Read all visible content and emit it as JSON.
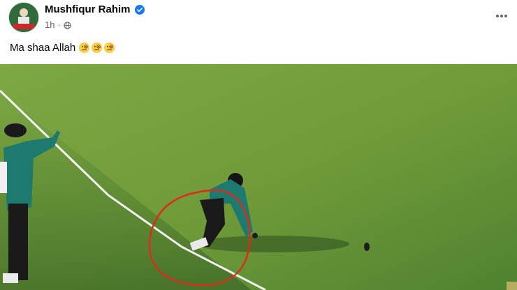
{
  "post": {
    "author": "Mushfiqur Rahim",
    "timestamp": "1h",
    "separator": "·",
    "caption": "Ma shaa Allah",
    "caption_emojis": [
      "face-with-monocle",
      "face-with-monocle",
      "face-with-monocle"
    ],
    "verified": true
  },
  "colors": {
    "field": "#6f9a3a",
    "field_shadow": "#4a7a2e",
    "annotation_circle": "#e0291a",
    "verified_badge": "#1877f2"
  },
  "icons": {
    "more": "more-horizontal-icon",
    "verified": "verified-badge-icon",
    "audience": "globe-icon"
  }
}
